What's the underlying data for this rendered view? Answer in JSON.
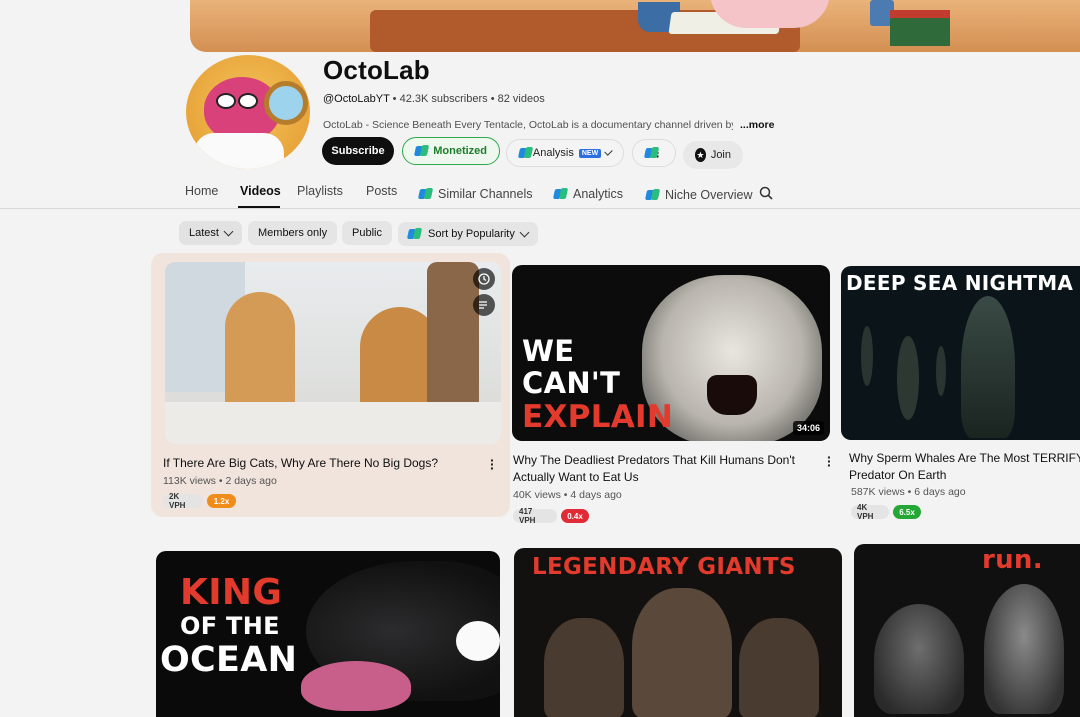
{
  "channel": {
    "name": "OctoLab",
    "handle": "@OctoLabYT",
    "subscribers": "42.3K subscribers",
    "videos_count": "82 videos",
    "separator": "•",
    "description": "OctoLab - Science Beneath Every Tentacle, OctoLab is a documentary channel driven by",
    "more": "...more"
  },
  "actions": {
    "subscribe": "Subscribe",
    "monetized": "Monetized",
    "analysis": "Analysis",
    "analysis_badge": "NEW",
    "ext_more": "⋮",
    "join": "Join"
  },
  "tabs": [
    {
      "label": "Home"
    },
    {
      "label": "Videos"
    },
    {
      "label": "Playlists"
    },
    {
      "label": "Posts"
    },
    {
      "label": "Similar Channels"
    },
    {
      "label": "Analytics"
    },
    {
      "label": "Niche Overview"
    }
  ],
  "filters": {
    "latest": "Latest",
    "members_only": "Members only",
    "public": "Public",
    "sort": "Sort by Popularity"
  },
  "videos": [
    {
      "title": "If There Are Big Cats, Why Are There No Big Dogs?",
      "views": "113K views",
      "age": "2 days ago",
      "vph": "2K VPH",
      "ratio": "1.2x"
    },
    {
      "title_line1": "Why The Deadliest Predators That Kill Humans Don't",
      "title_line2": "Actually Want to Eat Us",
      "views": "40K views",
      "age": "4 days ago",
      "vph": "417 VPH",
      "ratio": "0.4x",
      "duration": "34:06",
      "thumb_text": [
        "WE",
        "CAN'T",
        "EXPLAIN"
      ]
    },
    {
      "title_line1": "Why Sperm Whales Are The Most TERRIFYI",
      "title_line2": "Predator On Earth",
      "views": "587K views",
      "age": "6 days ago",
      "vph": "4K VPH",
      "ratio": "6.5x",
      "thumb_text": "DEEP SEA NIGHTMA"
    },
    {
      "thumb_text": [
        "KING",
        "OF THE",
        "OCEAN"
      ]
    },
    {
      "thumb_text": "LEGENDARY GIANTS"
    },
    {
      "thumb_text": "run."
    }
  ]
}
